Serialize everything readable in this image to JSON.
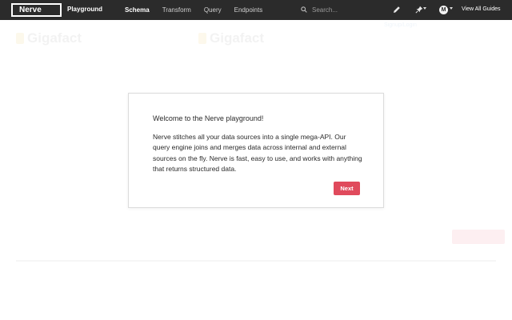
{
  "header": {
    "logo_text": "Nerve",
    "app_title": "Playground",
    "tabs": [
      {
        "label": "Schema",
        "active": true
      },
      {
        "label": "Transform",
        "active": false
      },
      {
        "label": "Query",
        "active": false
      },
      {
        "label": "Endpoints",
        "active": false
      }
    ],
    "search": {
      "placeholder": "Search...",
      "icon": "search-icon"
    },
    "tools": {
      "edit_icon": "pencil-icon",
      "pin_icon": "pin-icon",
      "pin_menu_icon": "chevron-down-icon"
    },
    "user": {
      "avatar_initial": "M",
      "menu_icon": "chevron-down-icon"
    },
    "guides_label": "View All Guides",
    "colors": {
      "bar_background": "#2b2b2b",
      "text": "#ffffff"
    }
  },
  "background": {
    "logo_text": "Gigafact",
    "logo_text_center": "Gigafact",
    "label_text": "Signup/Login"
  },
  "modal": {
    "title": "Welcome to the Nerve playground!",
    "body": "Nerve stitches all your data sources into a single mega-API. Our query engine joins and merges data across internal and external sources on the fly. Nerve is fast, easy to use, and works with anything that returns structured data.",
    "next_label": "Next",
    "accent_color": "#e04a5c"
  }
}
